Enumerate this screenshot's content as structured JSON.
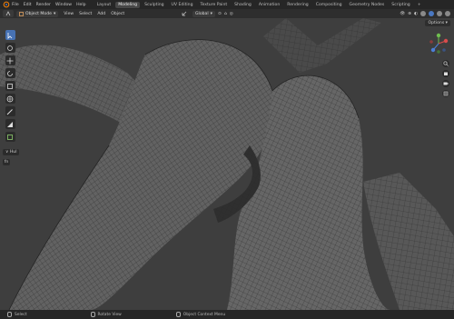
{
  "menu": [
    "File",
    "Edit",
    "Render",
    "Window",
    "Help"
  ],
  "workspaces": [
    "Layout",
    "Modeling",
    "Sculpting",
    "UV Editing",
    "Texture Paint",
    "Shading",
    "Animation",
    "Rendering",
    "Compositing",
    "Geometry Nodes",
    "Scripting"
  ],
  "active_workspace": "Modeling",
  "header": {
    "mode": "Object Mode",
    "view_menu": [
      "View",
      "Select",
      "Add",
      "Object"
    ],
    "orientation": "Global"
  },
  "options_label": "Options",
  "hul_label": "Hul",
  "status": {
    "select": "Select",
    "rotate": "Rotate View",
    "context": "Object Context Menu"
  },
  "colors": {
    "wire": "#1d1d1d",
    "surface": "#5a5a5a",
    "accent": "#4772b3"
  }
}
